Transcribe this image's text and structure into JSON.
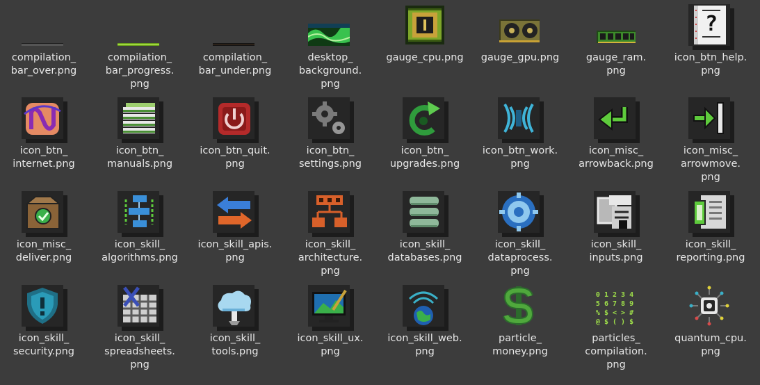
{
  "files": [
    {
      "name": [
        "compilation_",
        "bar_over.png"
      ],
      "icon": "bar-over-icon"
    },
    {
      "name": [
        "compilation_",
        "bar_progress.",
        "png"
      ],
      "icon": "bar-progress-icon"
    },
    {
      "name": [
        "compilation_",
        "bar_under.png"
      ],
      "icon": "bar-under-icon"
    },
    {
      "name": [
        "desktop_",
        "background.",
        "png"
      ],
      "icon": "desktop-background-icon"
    },
    {
      "name": [
        "gauge_cpu.png"
      ],
      "icon": "cpu-chip-icon"
    },
    {
      "name": [
        "gauge_gpu.png"
      ],
      "icon": "gpu-card-icon"
    },
    {
      "name": [
        "gauge_ram.",
        "png"
      ],
      "icon": "ram-stick-icon"
    },
    {
      "name": [
        "icon_btn_help.",
        "png"
      ],
      "icon": "help-document-icon"
    },
    {
      "name": [
        "icon_btn_",
        "internet.png"
      ],
      "icon": "internet-icon"
    },
    {
      "name": [
        "icon_btn_",
        "manuals.png"
      ],
      "icon": "manuals-stack-icon"
    },
    {
      "name": [
        "icon_btn_quit.",
        "png"
      ],
      "icon": "power-icon"
    },
    {
      "name": [
        "icon_btn_",
        "settings.png"
      ],
      "icon": "gears-icon"
    },
    {
      "name": [
        "icon_btn_",
        "upgrades.png"
      ],
      "icon": "upgrade-arrow-icon"
    },
    {
      "name": [
        "icon_btn_work.",
        "png"
      ],
      "icon": "work-waves-icon"
    },
    {
      "name": [
        "icon_misc_",
        "arrowback.png"
      ],
      "icon": "arrow-back-icon"
    },
    {
      "name": [
        "icon_misc_",
        "arrowmove.",
        "png"
      ],
      "icon": "arrow-move-icon"
    },
    {
      "name": [
        "icon_misc_",
        "deliver.png"
      ],
      "icon": "delivery-box-icon"
    },
    {
      "name": [
        "icon_skill_",
        "algorithms.png"
      ],
      "icon": "flowchart-icon"
    },
    {
      "name": [
        "icon_skill_apis.",
        "png"
      ],
      "icon": "api-arrows-icon"
    },
    {
      "name": [
        "icon_skill_",
        "architecture.",
        "png"
      ],
      "icon": "architecture-tree-icon"
    },
    {
      "name": [
        "icon_skill_",
        "databases.png"
      ],
      "icon": "database-icon"
    },
    {
      "name": [
        "icon_skill_",
        "dataprocess.",
        "png"
      ],
      "icon": "dataprocess-gear-icon"
    },
    {
      "name": [
        "icon_skill_",
        "inputs.png"
      ],
      "icon": "inputs-icon"
    },
    {
      "name": [
        "icon_skill_",
        "reporting.png"
      ],
      "icon": "reporting-document-icon"
    },
    {
      "name": [
        "icon_skill_",
        "security.png"
      ],
      "icon": "security-shield-icon"
    },
    {
      "name": [
        "icon_skill_",
        "spreadsheets.",
        "png"
      ],
      "icon": "spreadsheet-icon"
    },
    {
      "name": [
        "icon_skill_",
        "tools.png"
      ],
      "icon": "cloud-tools-icon"
    },
    {
      "name": [
        "icon_skill_ux.",
        "png"
      ],
      "icon": "ux-monitor-icon"
    },
    {
      "name": [
        "icon_skill_web.",
        "png"
      ],
      "icon": "web-globe-icon"
    },
    {
      "name": [
        "particle_",
        "money.png"
      ],
      "icon": "dollar-icon"
    },
    {
      "name": [
        "particles_",
        "compilation.",
        "png"
      ],
      "icon": "compilation-glyphs-icon"
    },
    {
      "name": [
        "quantum_cpu.",
        "png"
      ],
      "icon": "quantum-cpu-icon"
    }
  ],
  "glyphs": [
    "0 1 2 3 4",
    "5 6 7 8 9",
    "% $ < > #",
    "@ $ ( ) $"
  ]
}
